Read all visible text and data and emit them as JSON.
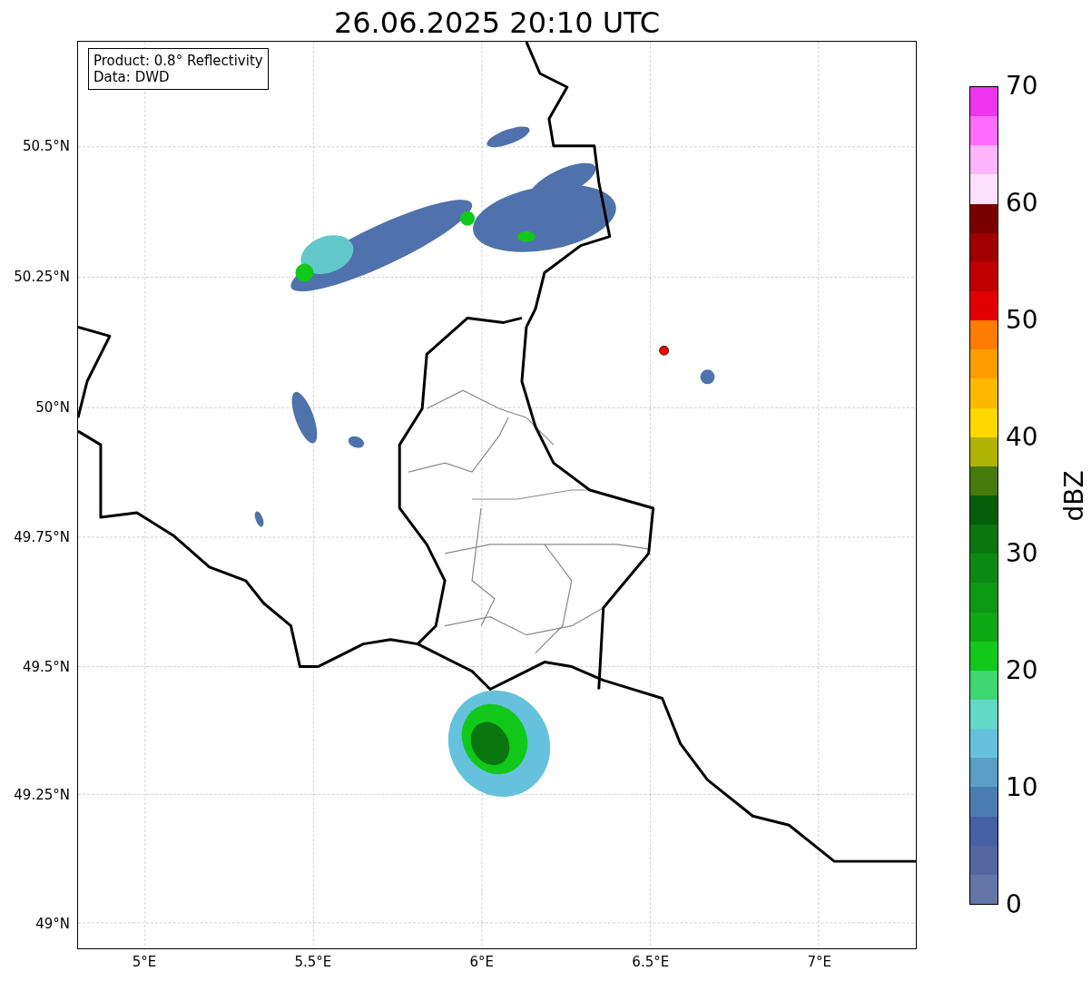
{
  "title": "26.06.2025 20:10 UTC",
  "info_box": [
    "Product: 0.8° Reflectivity",
    "Data: DWD"
  ],
  "map": {
    "lat_labels": [
      "50.5°N",
      "50.25°N",
      "50°N",
      "49.75°N",
      "49.5°N",
      "49.25°N",
      "49°N"
    ],
    "lon_labels": [
      "5°E",
      "5.5°E",
      "6°E",
      "6.5°E",
      "7°E"
    ]
  },
  "colorbar": {
    "label": "dBZ",
    "ticks": [
      "70",
      "60",
      "50",
      "40",
      "30",
      "20",
      "10",
      "0"
    ],
    "segments": [
      {
        "color": "#6374a6"
      },
      {
        "color": "#5366a0"
      },
      {
        "color": "#4560a4"
      },
      {
        "color": "#4a7cb2"
      },
      {
        "color": "#5a9ec6"
      },
      {
        "color": "#66c2dc"
      },
      {
        "color": "#62d8c6"
      },
      {
        "color": "#3ed670"
      },
      {
        "color": "#12c81a"
      },
      {
        "color": "#10a814"
      },
      {
        "color": "#0c9814"
      },
      {
        "color": "#0a8a12"
      },
      {
        "color": "#0a7610"
      },
      {
        "color": "#065e0a"
      },
      {
        "color": "#467a0a"
      },
      {
        "color": "#b0b204"
      },
      {
        "color": "#ffd800"
      },
      {
        "color": "#ffb800"
      },
      {
        "color": "#ff9c00"
      },
      {
        "color": "#ff7c00"
      },
      {
        "color": "#e00000"
      },
      {
        "color": "#c00000"
      },
      {
        "color": "#a00000"
      },
      {
        "color": "#7a0000"
      },
      {
        "color": "#ffe0ff"
      },
      {
        "color": "#ffb4ff"
      },
      {
        "color": "#ff6cff"
      },
      {
        "color": "#ee34ee"
      }
    ]
  }
}
